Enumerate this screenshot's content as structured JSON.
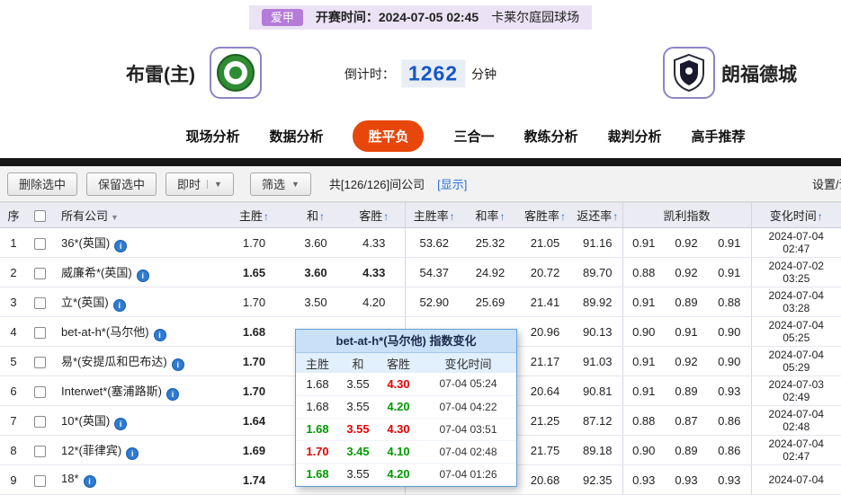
{
  "banner": {
    "league": "爱甲",
    "kickoff": "开赛时间：2024-07-05 02:45",
    "venue": "卡莱尔庭园球场"
  },
  "match": {
    "home_team": "布雷(主)",
    "away_team": "朗福德城",
    "countdown_label": "倒计时：",
    "countdown_value": "1262",
    "countdown_unit": "分钟"
  },
  "tabs": [
    {
      "label": "现场分析"
    },
    {
      "label": "数据分析"
    },
    {
      "label": "胜平负"
    },
    {
      "label": "三合一"
    },
    {
      "label": "教练分析"
    },
    {
      "label": "裁判分析"
    },
    {
      "label": "高手推荐"
    }
  ],
  "toolbar": {
    "delete_selected": "删除选中",
    "keep_selected": "保留选中",
    "live": "即时",
    "filter": "筛选",
    "company_count": "共[126/126]间公司",
    "show_link": "[显示]",
    "settings": "设置/说明"
  },
  "table": {
    "headers": {
      "seq": "序",
      "company": "所有公司",
      "home": "主胜",
      "draw": "和",
      "away": "客胜",
      "home_rate": "主胜率",
      "draw_rate": "和率",
      "away_rate": "客胜率",
      "return_rate": "返还率",
      "kelly": "凯利指数",
      "change_time": "变化时间"
    },
    "rows": [
      {
        "seq": "1",
        "company": "36*(英国)",
        "home": "1.70",
        "draw": "3.60",
        "away": "4.33",
        "home_rate": "53.62",
        "draw_rate": "25.32",
        "away_rate": "21.05",
        "return_rate": "91.16",
        "kelly_home": "0.91",
        "kelly_draw": "0.92",
        "kelly_away": "0.91",
        "date": "2024-07-04",
        "time": "02:47"
      },
      {
        "seq": "2",
        "company": "威廉希*(英国)",
        "home": "1.65",
        "draw": "3.60",
        "away": "4.33",
        "home_rate": "54.37",
        "draw_rate": "24.92",
        "away_rate": "20.72",
        "return_rate": "89.70",
        "kelly_home": "0.88",
        "kelly_draw": "0.92",
        "kelly_away": "0.91",
        "date": "2024-07-02",
        "time": "03:25"
      },
      {
        "seq": "3",
        "company": "立*(英国)",
        "home": "1.70",
        "draw": "3.50",
        "away": "4.20",
        "home_rate": "52.90",
        "draw_rate": "25.69",
        "away_rate": "21.41",
        "return_rate": "89.92",
        "kelly_home": "0.91",
        "kelly_draw": "0.89",
        "kelly_away": "0.88",
        "date": "2024-07-04",
        "time": "03:28"
      },
      {
        "seq": "4",
        "company": "bet-at-h*(马尔他)",
        "home": "1.68",
        "draw": "",
        "away": "",
        "home_rate": "",
        "draw_rate": "",
        "away_rate": "20.96",
        "return_rate": "90.13",
        "kelly_home": "0.90",
        "kelly_draw": "0.91",
        "kelly_away": "0.90",
        "date": "2024-07-04",
        "time": "05:25"
      },
      {
        "seq": "5",
        "company": "易*(安提瓜和巴布达)",
        "home": "1.70",
        "draw": "",
        "away": "",
        "home_rate": "",
        "draw_rate": "",
        "away_rate": "21.17",
        "return_rate": "91.03",
        "kelly_home": "0.91",
        "kelly_draw": "0.92",
        "kelly_away": "0.90",
        "date": "2024-07-04",
        "time": "05:29"
      },
      {
        "seq": "6",
        "company": "Interwet*(塞浦路斯)",
        "home": "1.70",
        "draw": "",
        "away": "",
        "home_rate": "",
        "draw_rate": "",
        "away_rate": "20.64",
        "return_rate": "90.81",
        "kelly_home": "0.91",
        "kelly_draw": "0.89",
        "kelly_away": "0.93",
        "date": "2024-07-03",
        "time": "02:49"
      },
      {
        "seq": "7",
        "company": "10*(英国)",
        "home": "1.64",
        "draw": "",
        "away": "",
        "home_rate": "",
        "draw_rate": "",
        "away_rate": "21.25",
        "return_rate": "87.12",
        "kelly_home": "0.88",
        "kelly_draw": "0.87",
        "kelly_away": "0.86",
        "date": "2024-07-04",
        "time": "02:48"
      },
      {
        "seq": "8",
        "company": "12*(菲律宾)",
        "home": "1.69",
        "draw": "",
        "away": "",
        "home_rate": "",
        "draw_rate": "",
        "away_rate": "21.75",
        "return_rate": "89.18",
        "kelly_home": "0.90",
        "kelly_draw": "0.89",
        "kelly_away": "0.86",
        "date": "2024-07-04",
        "time": "02:47"
      },
      {
        "seq": "9",
        "company": "18*",
        "home": "1.74",
        "draw": "",
        "away": "",
        "home_rate": "",
        "draw_rate": "",
        "away_rate": "20.68",
        "return_rate": "92.35",
        "kelly_home": "0.93",
        "kelly_draw": "0.93",
        "kelly_away": "0.93",
        "date": "2024-07-04",
        "time": ""
      }
    ]
  },
  "popup": {
    "title": "bet-at-h*(马尔他) 指数变化",
    "headers": {
      "home": "主胜",
      "draw": "和",
      "away": "客胜",
      "time": "变化时间"
    },
    "rows": [
      {
        "home": "1.68",
        "draw": "3.55",
        "away": "4.30",
        "time": "07-04 05:24"
      },
      {
        "home": "1.68",
        "draw": "3.55",
        "away": "4.20",
        "time": "07-04 04:22"
      },
      {
        "home": "1.68",
        "draw": "3.55",
        "away": "4.30",
        "time": "07-04 03:51"
      },
      {
        "home": "1.70",
        "draw": "3.45",
        "away": "4.10",
        "time": "07-04 02:48"
      },
      {
        "home": "1.68",
        "draw": "3.55",
        "away": "4.20",
        "time": "07-04 01:26"
      }
    ]
  },
  "palette": {
    "odds_up": "#e60000",
    "odds_down": "#009900",
    "active_tab": "#e8470b",
    "link": "#2a6fd6",
    "countdown": "#1257c8"
  }
}
